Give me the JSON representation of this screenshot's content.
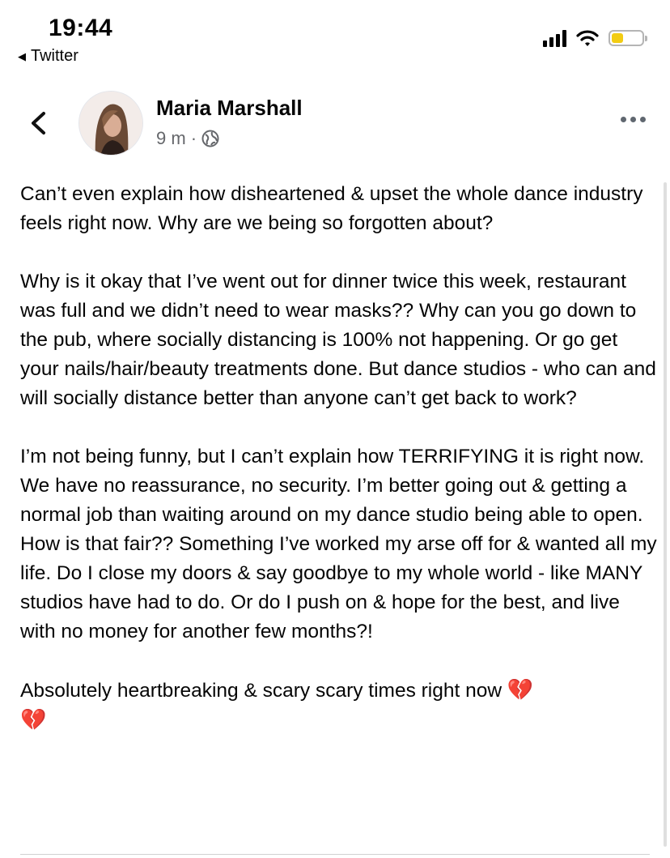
{
  "status_bar": {
    "time": "19:44",
    "back_app": "Twitter",
    "icons": [
      "signal-icon",
      "wifi-icon",
      "battery-icon"
    ],
    "battery_color": "#f2cc13"
  },
  "post": {
    "author": "Maria Marshall",
    "time_ago": "9 m",
    "separator": "·",
    "privacy_icon": "globe-icon",
    "paragraphs": [
      "Can’t even explain how disheartened & upset the whole dance industry feels right now. Why are we being so forgotten about?",
      "Why is it okay that I’ve went out for dinner twice this week, restaurant was full and we didn’t need to wear masks?? Why can you go down to the pub, where socially distancing is 100% not happening. Or go get your nails/hair/beauty treatments done. But dance studios - who can and will socially distance better than anyone can’t get back to work?",
      "I’m not being funny, but I can’t explain how TERRIFYING it is right now. We have no reassurance, no security. I’m better going out & getting a normal job than waiting around on my dance studio being able to open. How is that fair?? Something I’ve worked my arse off for & wanted all my life. Do I close my doors & say goodbye to my whole world - like MANY studios have had to do. Or do I push on & hope for the best, and live with no money for another few months?!",
      "Absolutely heartbreaking & scary scary times right now"
    ],
    "emoji_1": "💔",
    "emoji_2": "💔"
  }
}
